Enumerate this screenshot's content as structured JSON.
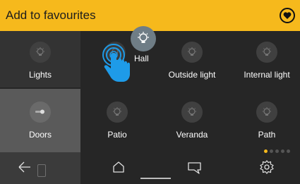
{
  "header": {
    "title": "Add to favourites",
    "favourite_icon": "heart-circle-icon",
    "background": "#f6b91c"
  },
  "tiles": [
    {
      "label": "Lights",
      "icon": "light-bulb-icon"
    },
    {
      "label": "Hall",
      "icon": "light-bulb-icon",
      "state": "being-dragged"
    },
    {
      "label": "Outside light",
      "icon": "light-bulb-icon"
    },
    {
      "label": "Internal light",
      "icon": "light-bulb-icon"
    },
    {
      "label": "Doors",
      "icon": "door-lock-icon"
    },
    {
      "label": "Patio",
      "icon": "light-bulb-icon"
    },
    {
      "label": "Veranda",
      "icon": "light-bulb-icon"
    },
    {
      "label": "Path",
      "icon": "light-bulb-icon"
    }
  ],
  "pagination": {
    "pages": 5,
    "active": 1
  },
  "nav": {
    "back_icon": "back-arrow-icon",
    "home_icon": "home-icon",
    "messages_icon": "chat-bubble-icon",
    "settings_icon": "gear-icon"
  },
  "colors": {
    "accent": "#f6b91c",
    "touch_hand": "#1e9be8",
    "drag_handle": "#6f7d86"
  }
}
